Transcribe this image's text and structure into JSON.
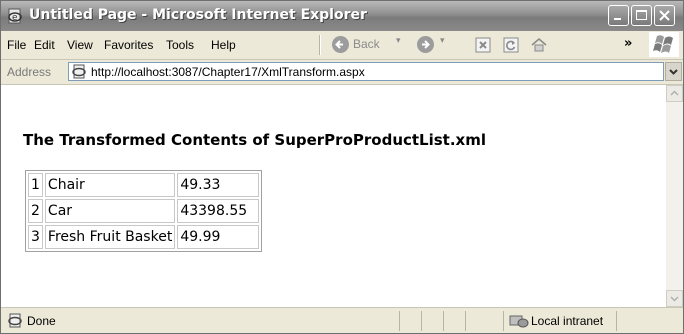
{
  "window": {
    "title": "Untitled Page - Microsoft Internet Explorer"
  },
  "menu": {
    "file": "File",
    "edit": "Edit",
    "view": "View",
    "favorites": "Favorites",
    "tools": "Tools",
    "help": "Help",
    "back": "Back",
    "chevron": "»"
  },
  "address": {
    "label": "Address",
    "url": "http://localhost:3087/Chapter17/XmlTransform.aspx"
  },
  "page": {
    "heading": "The Transformed Contents of SuperProProductList.xml",
    "rows": [
      {
        "id": "1",
        "name": "Chair",
        "price": "49.33"
      },
      {
        "id": "2",
        "name": "Car",
        "price": "43398.55"
      },
      {
        "id": "3",
        "name": "Fresh Fruit Basket",
        "price": "49.99"
      }
    ]
  },
  "status": {
    "text": "Done",
    "zone": "Local intranet"
  },
  "icons": {
    "app": "ie-page-icon",
    "minimize": "minimize-icon",
    "maximize": "maximize-icon",
    "close": "close-icon",
    "back": "back-arrow-icon",
    "forward": "forward-arrow-icon",
    "stop": "stop-icon",
    "refresh": "refresh-icon",
    "home": "home-icon"
  }
}
